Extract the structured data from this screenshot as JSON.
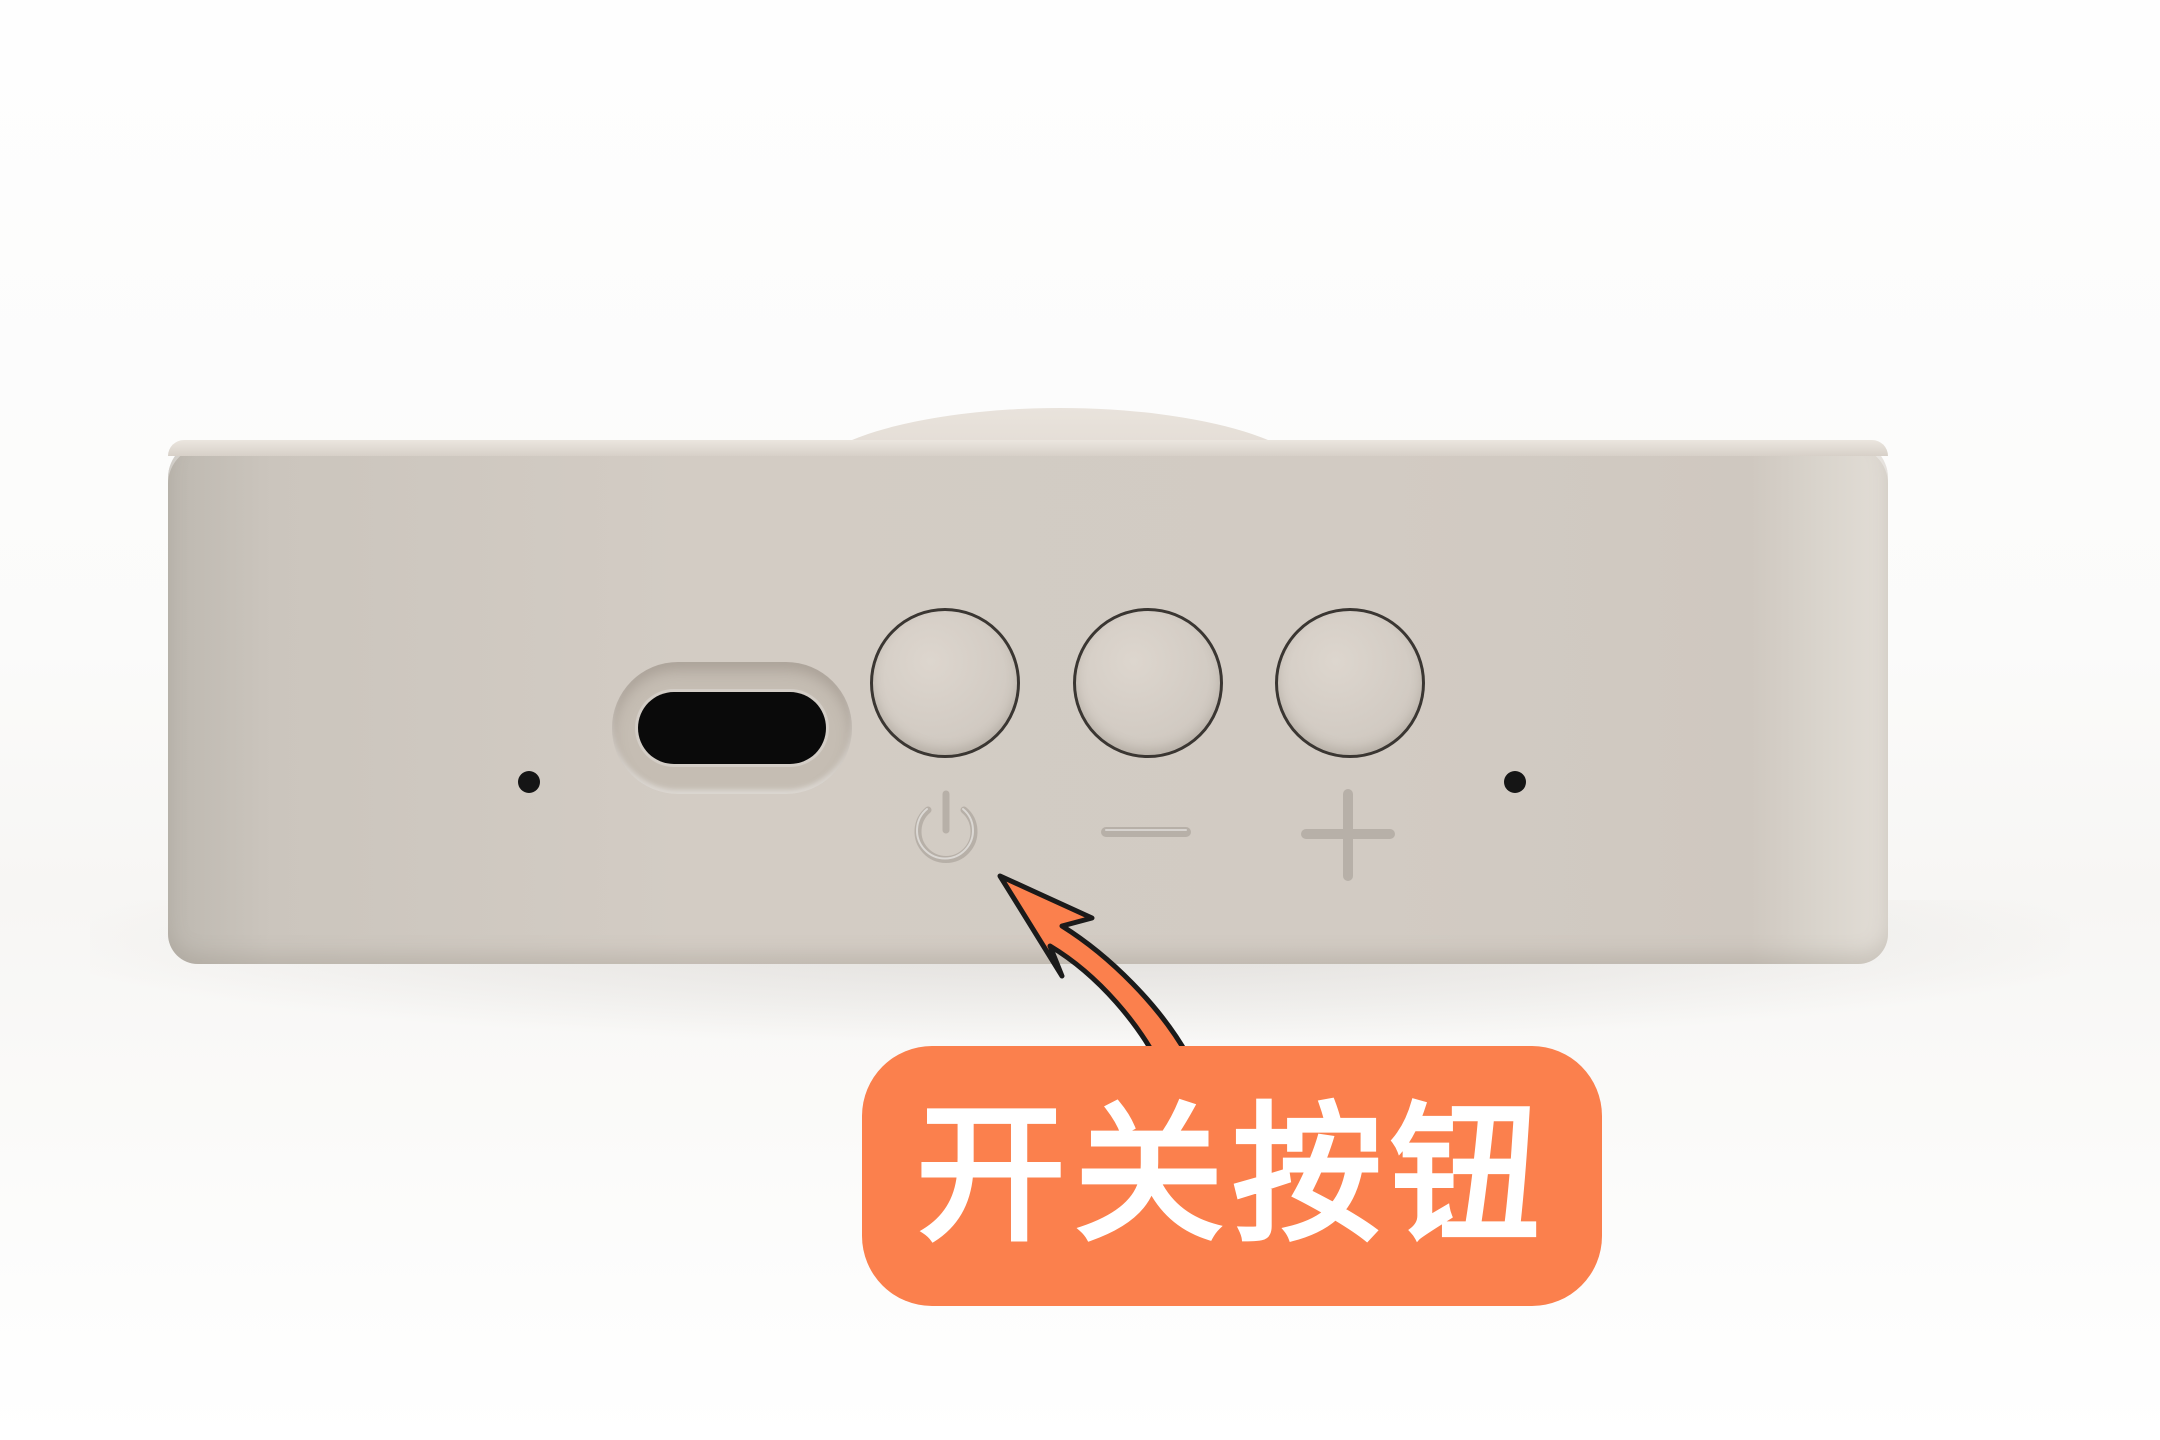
{
  "callout": {
    "label": "开关按钮",
    "color": "#fb804d",
    "text_color": "#ffffff"
  },
  "device": {
    "body_color": "#d2cbc3",
    "buttons": [
      {
        "name": "power-button",
        "symbol": "power-icon"
      },
      {
        "name": "volume-down-button",
        "symbol": "minus-icon"
      },
      {
        "name": "volume-up-button",
        "symbol": "plus-icon"
      }
    ],
    "port": "usb-c-port",
    "indicators": [
      "microphone-hole-left",
      "microphone-hole-right"
    ]
  }
}
